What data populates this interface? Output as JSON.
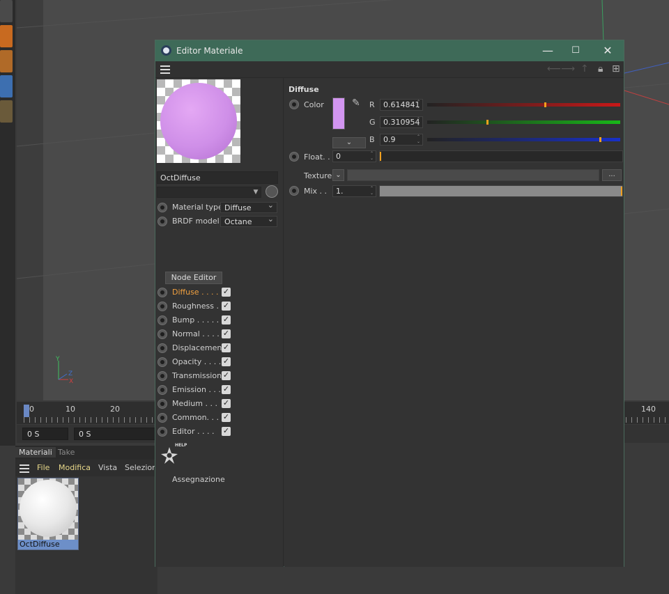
{
  "dialog": {
    "title": "Editor Materiale",
    "window_buttons": {
      "minimize": "—",
      "maximize": "☐",
      "close": "✕"
    }
  },
  "left_panel": {
    "material_name": "OctDiffuse",
    "properties": [
      {
        "label": "Material type",
        "value": "Diffuse"
      },
      {
        "label": "BRDF model",
        "value": "Octane"
      }
    ],
    "node_editor_label": "Node Editor",
    "channels": [
      {
        "label": "Diffuse . . . .",
        "checked": true,
        "active": true
      },
      {
        "label": "Roughness . .",
        "checked": true
      },
      {
        "label": "Bump . . . . .",
        "checked": true
      },
      {
        "label": "Normal . . . .",
        "checked": true
      },
      {
        "label": "Displacement",
        "checked": true
      },
      {
        "label": "Opacity . . . .",
        "checked": true
      },
      {
        "label": "Transmission",
        "checked": true
      },
      {
        "label": "Emission . . .",
        "checked": true
      },
      {
        "label": "Medium . . .",
        "checked": true
      },
      {
        "label": "Common. . . .",
        "checked": true
      },
      {
        "label": "Editor . . . .",
        "checked": true
      }
    ],
    "help_badge": "HELP",
    "assign_label": "Assegnazione",
    "active_color": "#f0a040"
  },
  "right_panel": {
    "section_title": "Diffuse",
    "color_label": "Color",
    "swatch_color": "#d295f0",
    "channels": [
      {
        "name": "R",
        "value": "0.614841",
        "fraction": 0.614841,
        "bar_color": "#c81818"
      },
      {
        "name": "G",
        "value": "0.310954",
        "fraction": 0.310954,
        "bar_color": "#18b818"
      },
      {
        "name": "B",
        "value": "0.9",
        "fraction": 0.9,
        "bar_color": "#1830c8"
      }
    ],
    "float_label": "Float. .",
    "float_value": "0",
    "float_fraction": 0,
    "texture_label": "Texture",
    "texture_button": "...",
    "mix_label": "Mix . .",
    "mix_value": "1.",
    "mix_fraction": 1
  },
  "background_app": {
    "timeline_labels": [
      "0",
      "10",
      "20",
      "140"
    ],
    "time_start": "0 S",
    "time_current": "0 S",
    "axis_labels": {
      "x": "X",
      "y": "Y",
      "z": "Z"
    },
    "material_manager": {
      "tabs": [
        "Materiali",
        "Take"
      ],
      "menu": [
        "File",
        "Modifica",
        "Vista",
        "Seleziona"
      ],
      "material_name": "OctDiffuse"
    }
  }
}
